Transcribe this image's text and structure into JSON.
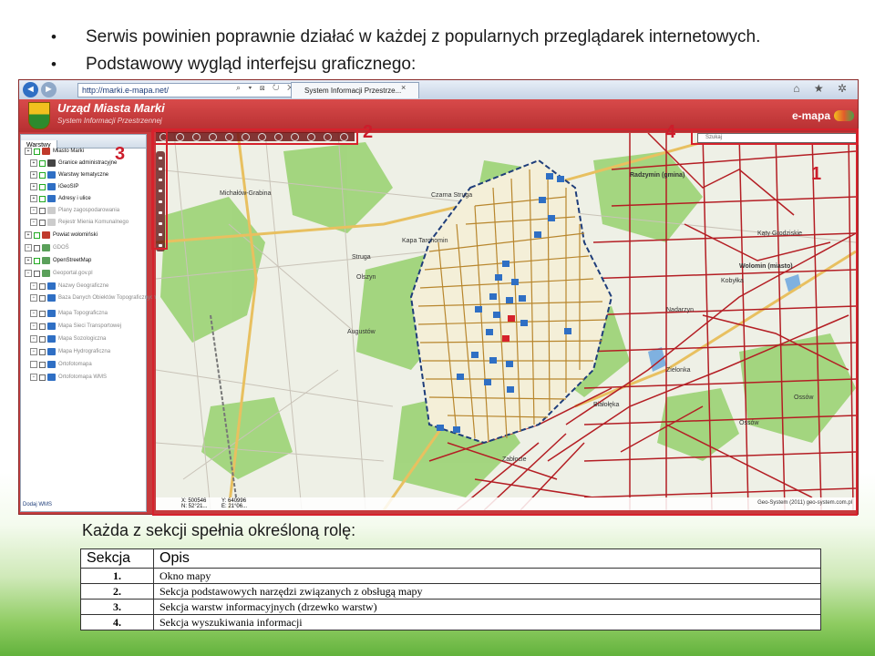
{
  "bullets": [
    "Serwis powinien poprawnie działać w każdej z popularnych przeglądarek internetowych.",
    "Podstawowy wygląd interfejsu graficznego:"
  ],
  "browser": {
    "url": "http://marki.e-mapa.net/",
    "tab_title": "System Informacji Przestrze...",
    "tab_close": "×",
    "nav_back": "◄",
    "nav_forward": "►",
    "addr_icons": "⌕ ▾ ⊠ ↻ ✕",
    "toolbar_icons": "⌂ ★ ✲"
  },
  "app": {
    "title": "Urząd Miasta Marki",
    "subtitle": "System Informacji Przestrzennej",
    "brand": "e-mapa"
  },
  "layers": {
    "tab": "Warstwy",
    "items": [
      {
        "label": "Miasto Marki",
        "color": "#c0392b",
        "checked": true,
        "expand": true
      },
      {
        "label": "Granice administracyjne",
        "color": "#444444",
        "checked": true,
        "expand": true
      },
      {
        "label": "Warstwy tematyczne",
        "color": "#2f6fc4",
        "checked": true,
        "expand": true
      },
      {
        "label": "iGeoSIP",
        "color": "#2f6fc4",
        "checked": true,
        "expand": true
      },
      {
        "label": "Adresy i ulice",
        "color": "#2f6fc4",
        "checked": true,
        "expand": true
      },
      {
        "label": "Plany zagospodarowania",
        "color": "#cccccc",
        "checked": false,
        "expand": true
      },
      {
        "label": "Rejestr Mienia Komunalnego",
        "color": "#cccccc",
        "checked": false,
        "expand": true
      },
      {
        "label": "Powiat wołomiński",
        "color": "#c0392b",
        "checked": true,
        "expand": true
      },
      {
        "label": "GDOŚ",
        "color": "#5aa05a",
        "checked": false,
        "expand": true
      },
      {
        "label": "OpenStreetMap",
        "color": "#5aa05a",
        "checked": true,
        "expand": true
      },
      {
        "label": "Geoportal.gov.pl",
        "color": "#5aa05a",
        "checked": false,
        "expand": true
      },
      {
        "label": "Nazwy Geograficzne",
        "color": "#2f6fc4",
        "checked": false,
        "expand": true
      },
      {
        "label": "Baza Danych Obiektów Topograficznych",
        "color": "#2f6fc4",
        "checked": false,
        "expand": true
      },
      {
        "label": "Mapa Topograficzna",
        "color": "#2f6fc4",
        "checked": false,
        "expand": true
      },
      {
        "label": "Mapa Sieci Transportowej",
        "color": "#2f6fc4",
        "checked": false,
        "expand": true
      },
      {
        "label": "Mapa Sozologiczna",
        "color": "#2f6fc4",
        "checked": false,
        "expand": true
      },
      {
        "label": "Mapa Hydrograficzna",
        "color": "#2f6fc4",
        "checked": false,
        "expand": true
      },
      {
        "label": "Ortofotomapa",
        "color": "#2f6fc4",
        "checked": false,
        "expand": false
      },
      {
        "label": "Ortofotomapa WMS",
        "color": "#2f6fc4",
        "checked": false,
        "expand": true
      }
    ],
    "footer": "Dodaj WMS"
  },
  "map": {
    "search_placeholder": "Szukaj",
    "coord_x": "X: 500546",
    "coord_y": "Y: 640996",
    "coord_lat": "N: 52°21...",
    "coord_lon": "E: 21°06...",
    "credits": "Geo-System (2011) geo-system.com.pl",
    "place_names": {
      "p1": "Czarna Struga",
      "p2": "Radzymin (gmina)",
      "p3": "Michałów-Grabina",
      "p4": "Kąty Grodziskie",
      "p5": "Wolomin (miasto)",
      "p6": "Kobyłka",
      "p7": "Zielonka",
      "p8": "Ossów",
      "p9": "Struga",
      "p10": "Augustów",
      "p11": "Olszyn",
      "p12": "Nadarzyn",
      "p13": "Kapa Tarchomin",
      "p14": "Białołęka",
      "p15": "Zabłocie",
      "p16": "Ossów"
    },
    "section_numbers": {
      "s1": "1",
      "s2": "2",
      "s3": "3",
      "s4": "4"
    }
  },
  "section_intro": "Każda z sekcji spełnia określoną rolę:",
  "table": {
    "headers": [
      "Sekcja",
      "Opis"
    ],
    "rows": [
      {
        "num": "1.",
        "desc": "Okno mapy"
      },
      {
        "num": "2.",
        "desc": "Sekcja podstawowych narzędzi związanych z obsługą mapy"
      },
      {
        "num": "3.",
        "desc": "Sekcja warstw informacyjnych (drzewko warstw)"
      },
      {
        "num": "4.",
        "desc": "Sekcja wyszukiwania informacji"
      }
    ]
  },
  "colors": {
    "accent": "#cc1d2b",
    "banner": "#c73b3d",
    "marki_roads": "#b8862d",
    "region_roads": "#b41e24",
    "forest": "#8fcf6a"
  }
}
